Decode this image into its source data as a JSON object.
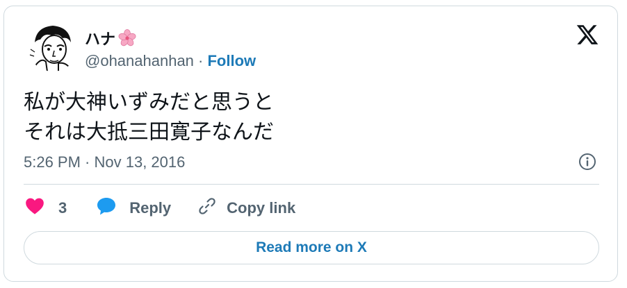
{
  "user": {
    "display_name": "ハナ",
    "name_emoji_icon": "cherry-blossom-icon",
    "handle": "@ohanahanhan",
    "separator": " · ",
    "follow_label": "Follow"
  },
  "tweet": {
    "lines": [
      "私が大神いずみだと思うと",
      "それは大抵三田寛子なんだ"
    ],
    "timestamp": "5:26 PM · Nov 13, 2016"
  },
  "actions": {
    "like_count": "3",
    "reply_label": "Reply",
    "copy_link_label": "Copy link"
  },
  "read_more_label": "Read more on X",
  "colors": {
    "link_blue": "#1d7ab7",
    "like_pink": "#f91880",
    "reply_blue": "#1d9bf0",
    "secondary_text": "#536471",
    "border": "#cfd9de"
  }
}
